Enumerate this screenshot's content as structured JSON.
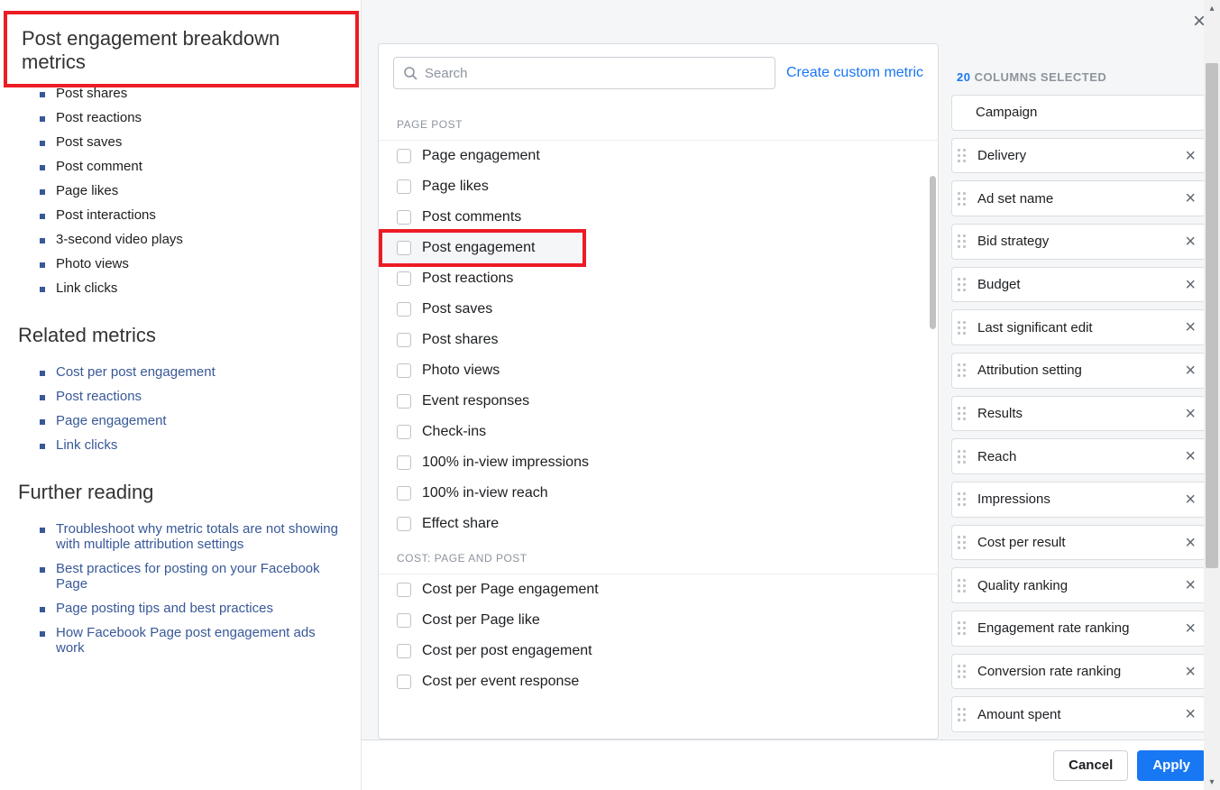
{
  "doc": {
    "title": "Post engagement breakdown metrics",
    "breakdown_items": [
      "Post shares",
      "Post reactions",
      "Post saves",
      "Post comment",
      "Page likes",
      "Post interactions",
      "3-second video plays",
      "Photo views",
      "Link clicks"
    ],
    "related_heading": "Related metrics",
    "related_items": [
      "Cost per post engagement",
      "Post reactions",
      "Page engagement",
      "Link clicks"
    ],
    "further_heading": "Further reading",
    "further_items": [
      "Troubleshoot why metric totals are not showing with multiple attribution settings",
      "Best practices for posting on your Facebook Page",
      "Page posting tips and best practices",
      "How Facebook Page post engagement ads work"
    ]
  },
  "search": {
    "placeholder": "Search"
  },
  "custom_metric_link": "Create custom metric",
  "groups": [
    {
      "header": "PAGE POST",
      "items": [
        "Page engagement",
        "Page likes",
        "Post comments",
        "Post engagement",
        "Post reactions",
        "Post saves",
        "Post shares",
        "Photo views",
        "Event responses",
        "Check-ins",
        "100% in-view impressions",
        "100% in-view reach",
        "Effect share"
      ],
      "highlighted_index": 3
    },
    {
      "header": "COST: PAGE AND POST",
      "items": [
        "Cost per Page engagement",
        "Cost per Page like",
        "Cost per post engagement",
        "Cost per event response"
      ]
    }
  ],
  "selected": {
    "count": "20",
    "label": "COLUMNS SELECTED",
    "locked": "Campaign",
    "items": [
      "Delivery",
      "Ad set name",
      "Bid strategy",
      "Budget",
      "Last significant edit",
      "Attribution setting",
      "Results",
      "Reach",
      "Impressions",
      "Cost per result",
      "Quality ranking",
      "Engagement rate ranking",
      "Conversion rate ranking",
      "Amount spent"
    ]
  },
  "footer": {
    "cancel": "Cancel",
    "apply": "Apply"
  }
}
